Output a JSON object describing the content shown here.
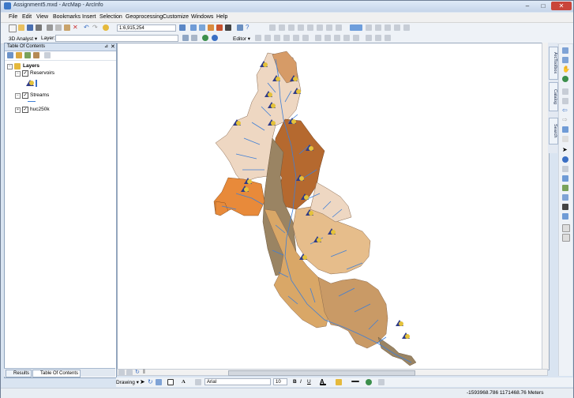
{
  "window": {
    "title": "Assignment5.mxd - ArcMap - ArcInfo",
    "min_label": "–",
    "max_label": "□",
    "close_label": "✕"
  },
  "menu": [
    "File",
    "Edit",
    "View",
    "Bookmarks",
    "Insert",
    "Selection",
    "Geoprocessing",
    "Customize",
    "Windows",
    "Help"
  ],
  "toolbar": {
    "scale_value": "1:6,915,254",
    "analyst_label": "3D Analyst ▾",
    "layer_label": "Layer:",
    "layer_value": "",
    "editor_label": "Editor ▾"
  },
  "toc": {
    "title": "Table Of Contents",
    "pin": "⊿",
    "close": "✕",
    "root_label": "Layers",
    "layers": [
      {
        "label": "Reservoirs",
        "checked": true
      },
      {
        "label": "Streams",
        "checked": true
      },
      {
        "label": "huc250k",
        "checked": true
      }
    ]
  },
  "tabs": {
    "results": "Results",
    "toc": "Table Of Contents"
  },
  "side_tabs": [
    "ArcToolbox",
    "Catalog",
    "Search"
  ],
  "drawing": {
    "drawing_label": "Drawing ▾",
    "font_name": "Arial",
    "font_size": "10",
    "bold": "B",
    "italic": "I",
    "underline": "U",
    "text_tool": "A"
  },
  "status": {
    "coords": "-1593968.786  1171468.76 Meters"
  },
  "colors": {
    "accent_blue": "#3a6fc4",
    "watershed_dark": "#b5692f",
    "watershed_orange": "#e88a3a",
    "watershed_tan": "#d9a767",
    "watershed_light": "#eed7c2",
    "stream": "#3f7fd6"
  }
}
